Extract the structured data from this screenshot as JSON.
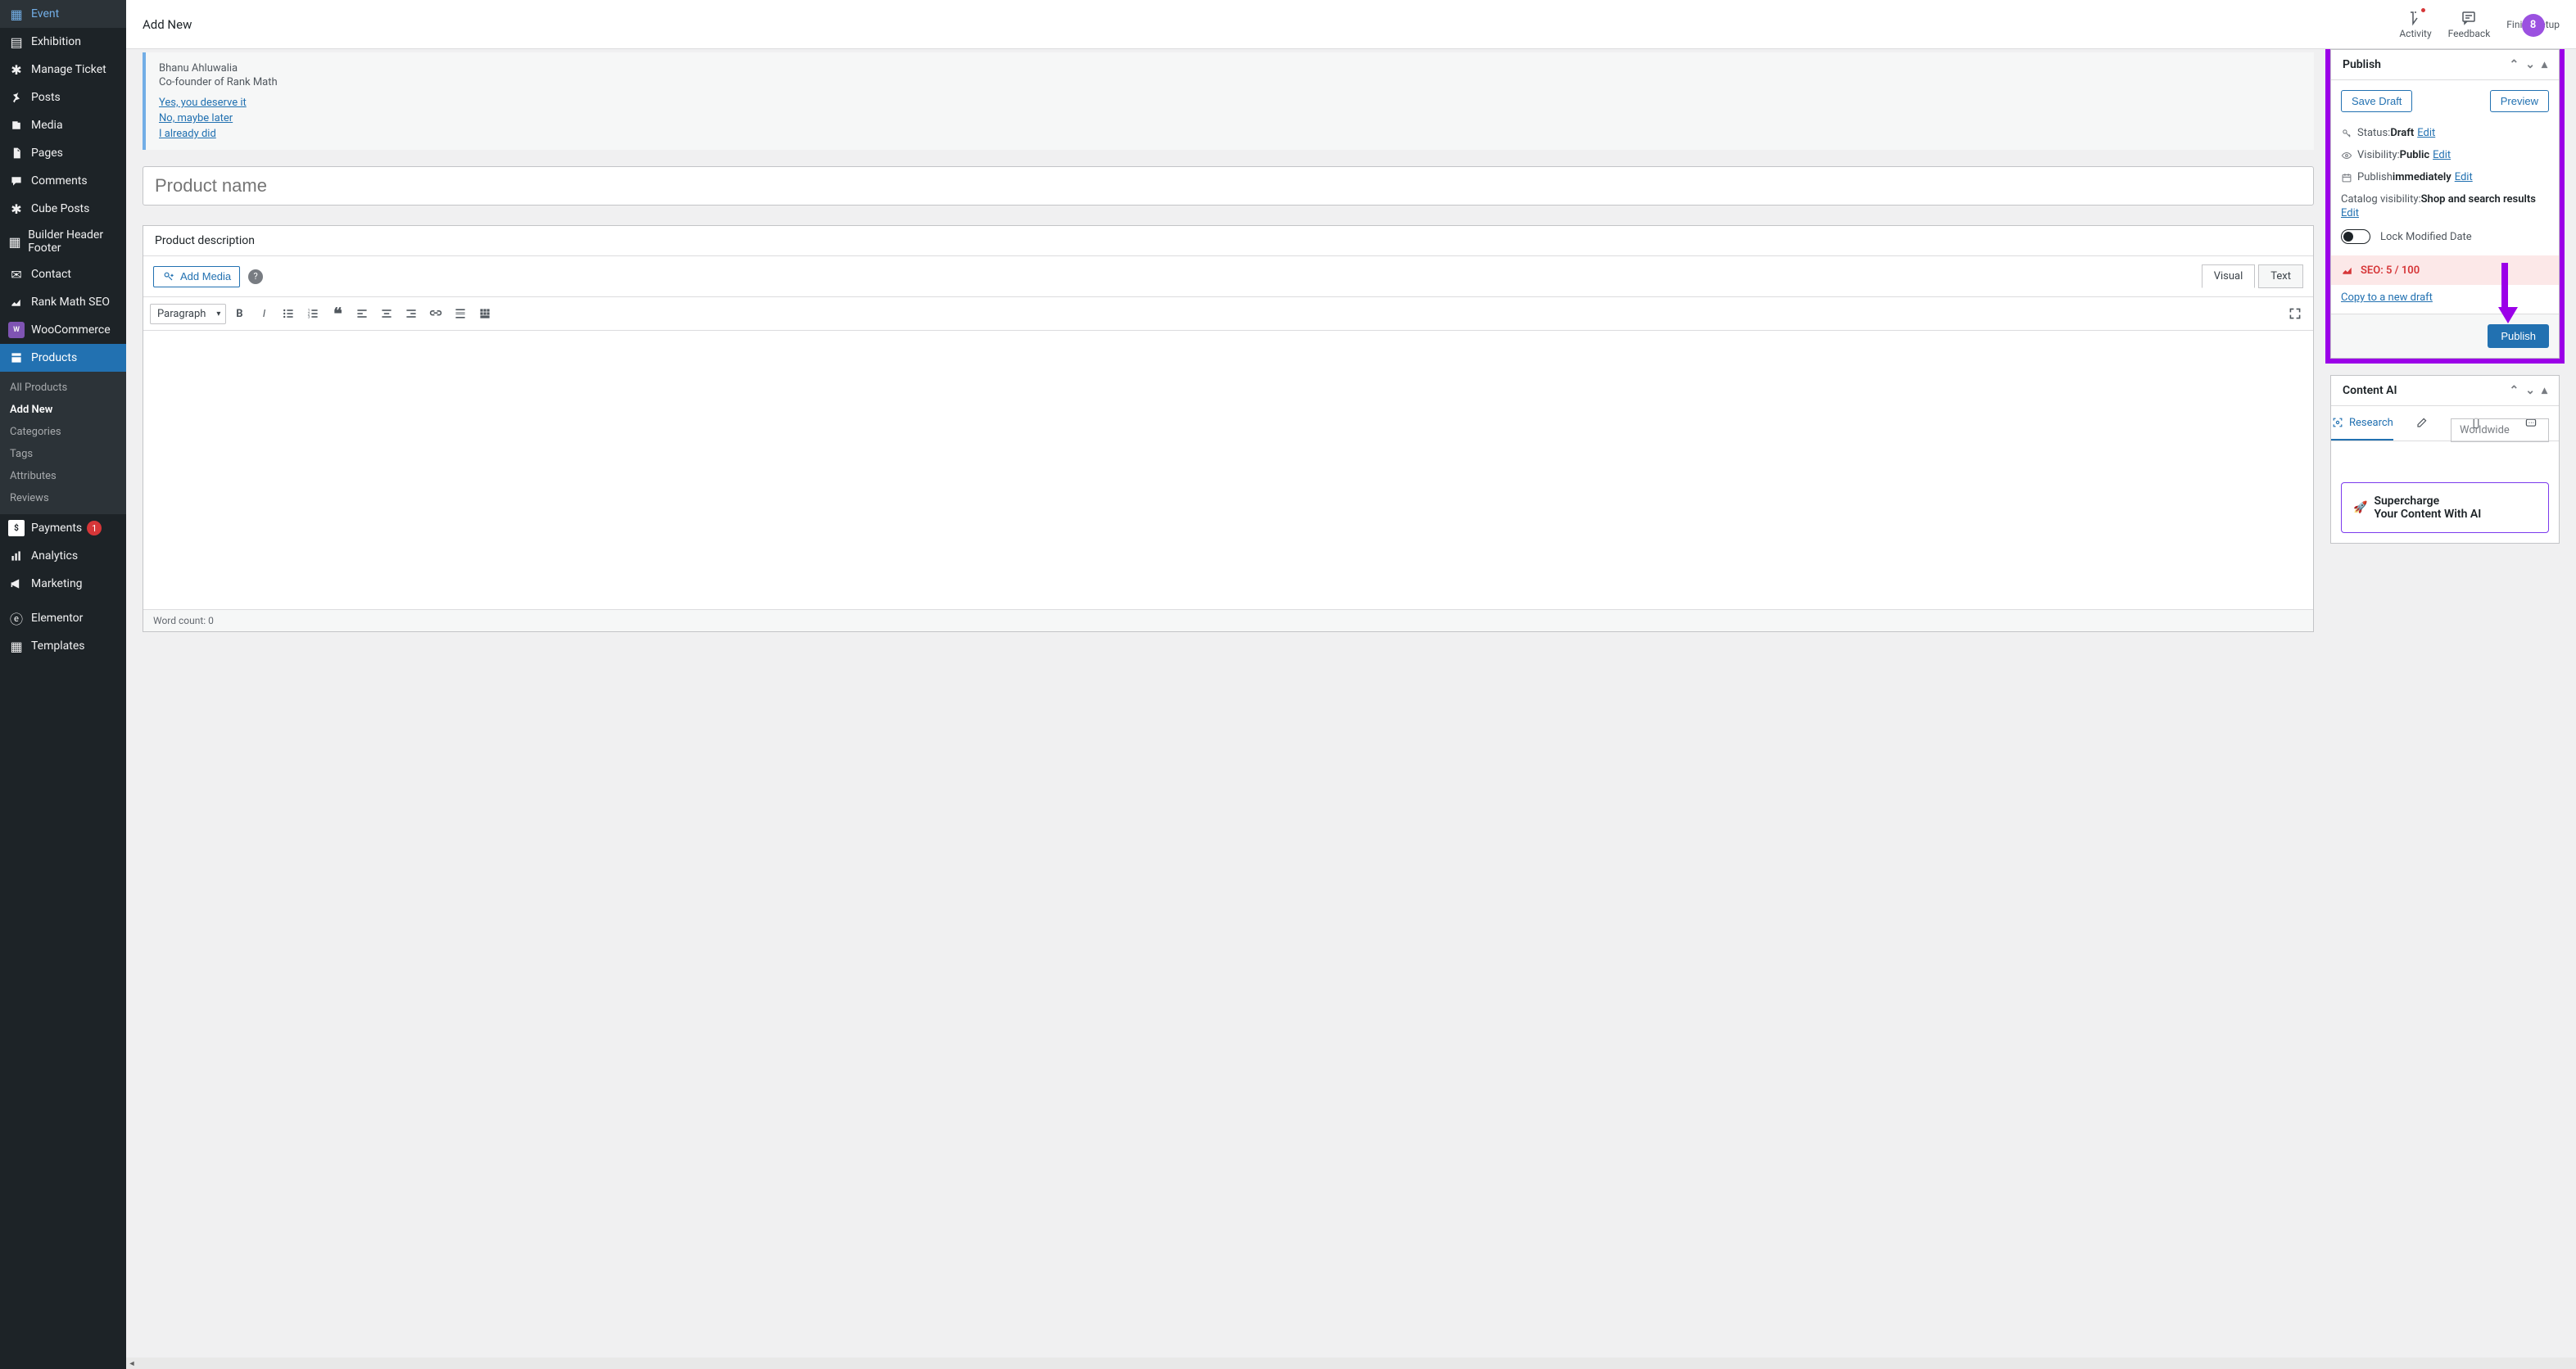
{
  "topbar": {
    "title": "Add New",
    "activity": "Activity",
    "feedback": "Feedback",
    "finish": "Finish setup",
    "avatar": "8"
  },
  "sidebar": {
    "event": "Event",
    "exhibition": "Exhibition",
    "manage_ticket": "Manage Ticket",
    "posts": "Posts",
    "media": "Media",
    "pages": "Pages",
    "comments": "Comments",
    "cube_posts": "Cube Posts",
    "builder": "Builder Header Footer",
    "contact": "Contact",
    "rank_math": "Rank Math SEO",
    "woocommerce": "WooCommerce",
    "products": "Products",
    "payments": "Payments",
    "payments_badge": "1",
    "analytics": "Analytics",
    "marketing": "Marketing",
    "elementor": "Elementor",
    "templates": "Templates",
    "sub": {
      "all_products": "All Products",
      "add_new": "Add New",
      "categories": "Categories",
      "tags": "Tags",
      "attributes": "Attributes",
      "reviews": "Reviews"
    }
  },
  "notice": {
    "author": "Bhanu Ahluwalia",
    "sub": "Co-founder of Rank Math",
    "yes": "Yes, you deserve it",
    "no": "No, maybe later",
    "already": "I already did"
  },
  "editor": {
    "title_placeholder": "Product name",
    "description_label": "Product description",
    "add_media": "Add Media",
    "visual": "Visual",
    "text": "Text",
    "format": "Paragraph",
    "word_count": "Word count: 0"
  },
  "publish": {
    "title": "Publish",
    "save_draft": "Save Draft",
    "preview": "Preview",
    "status_label": "Status: ",
    "status_value": "Draft",
    "visibility_label": "Visibility: ",
    "visibility_value": "Public",
    "publish_label": "Publish ",
    "publish_value": "immediately",
    "catalog_label": "Catalog visibility: ",
    "catalog_value": "Shop and search results",
    "edit": "Edit",
    "lock": "Lock Modified Date",
    "seo": "SEO: 5 / 100",
    "copy": "Copy to a new draft",
    "publish_btn": "Publish"
  },
  "content_ai": {
    "title": "Content AI",
    "research": "Research",
    "worldwide": "Worldwide",
    "popup_line1": "Supercharge",
    "popup_line2": "Your Content With AI"
  }
}
